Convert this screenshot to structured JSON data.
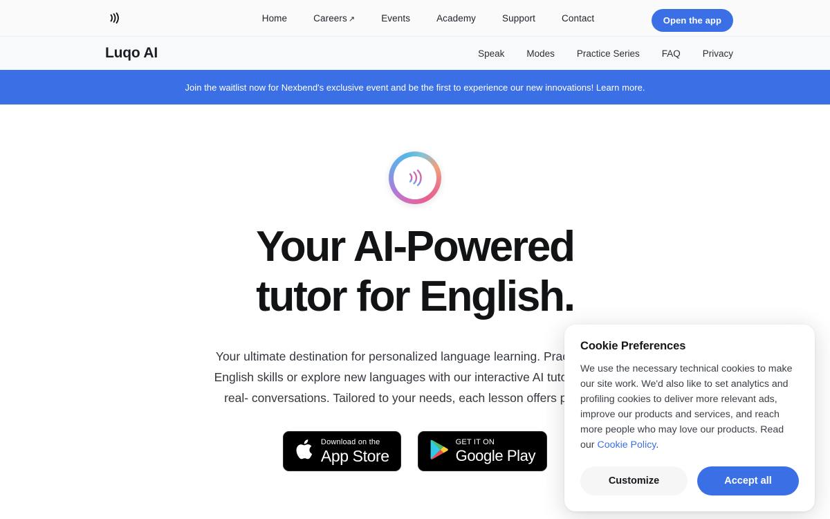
{
  "topnav": {
    "logo_icon": "sound-wave-icon",
    "links": [
      {
        "label": "Home",
        "external": false
      },
      {
        "label": "Careers",
        "external": true,
        "ext_glyph": "↗"
      },
      {
        "label": "Events",
        "external": false
      },
      {
        "label": "Academy",
        "external": false
      },
      {
        "label": "Support",
        "external": false
      },
      {
        "label": "Contact",
        "external": false
      }
    ],
    "cta_label": "Open the app",
    "cta_color": "#3b6fe6"
  },
  "subnav": {
    "brand": "Luqo AI",
    "links": [
      {
        "label": "Speak"
      },
      {
        "label": "Modes"
      },
      {
        "label": "Practice Series"
      },
      {
        "label": "FAQ"
      },
      {
        "label": "Privacy"
      }
    ]
  },
  "banner": {
    "text": "Join the waitlist now for Nexbend's exclusive event and be the first to experience our new innovations!",
    "link_label": "Learn more.",
    "background": "#3b6fe6",
    "text_color": "#ffffff"
  },
  "hero": {
    "logo_icon": "gradient-sound-wave-logo",
    "headline_line1": "Your AI-Powered",
    "headline_line2": "tutor for English.",
    "subtext": "Your ultimate destination for personalized language learning. Practice your English skills or explore new languages with our interactive AI tutor through real- conversations. Tailored to your needs, each lesson offers practice.",
    "stores": [
      {
        "icon": "apple-logo-icon",
        "small": "Download on the",
        "big": "App Store"
      },
      {
        "icon": "google-play-icon",
        "small": "GET IT ON",
        "big": "Google Play"
      }
    ]
  },
  "cookie_dialog": {
    "title": "Cookie Preferences",
    "body_before_link": "We use the necessary technical cookies to make our site work. We'd also like to set analytics and profiling cookies to deliver more relevant ads, improve our products and services, and reach more people who may love our products. Read our ",
    "link_label": "Cookie Policy",
    "body_after_link": ".",
    "customize_label": "Customize",
    "accept_label": "Accept all",
    "accept_color": "#3b6fe6"
  }
}
